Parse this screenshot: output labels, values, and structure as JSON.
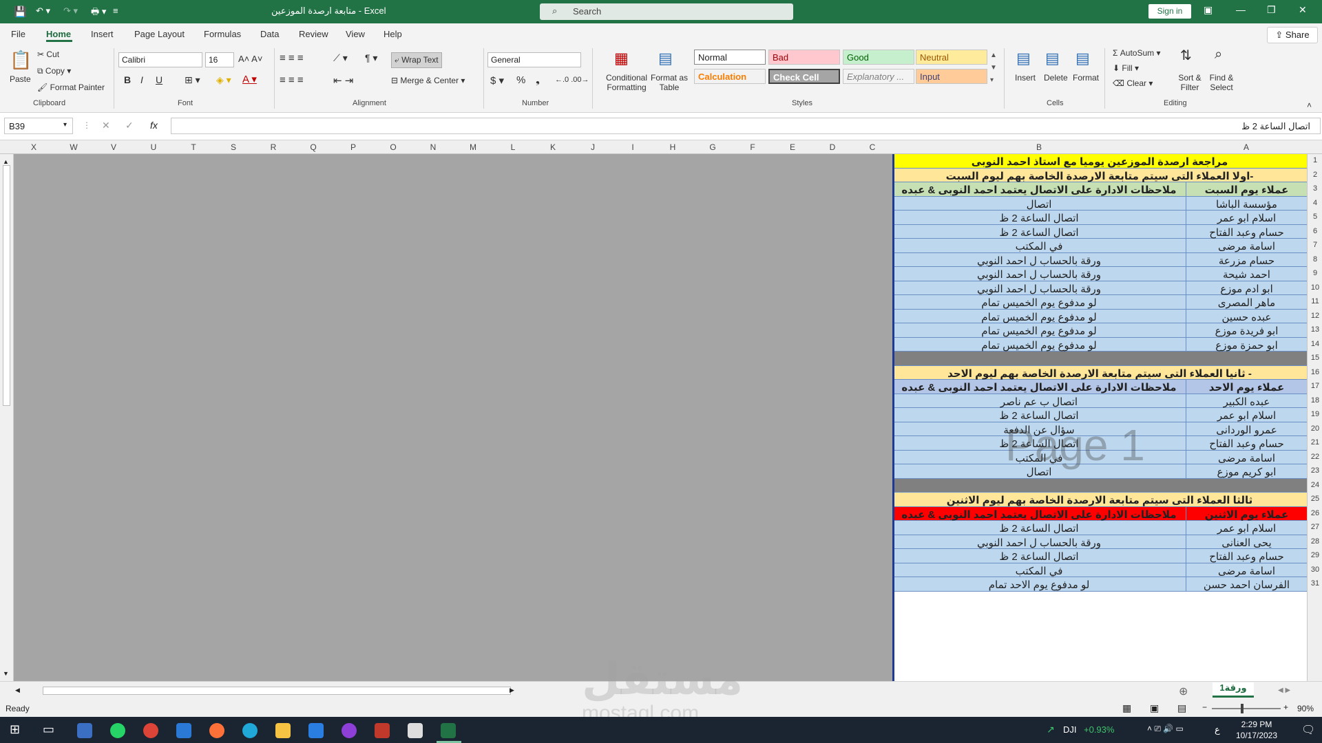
{
  "window": {
    "title": "متابعة ارصدة الموزعين  -  Excel",
    "search_placeholder": "Search",
    "sign_in": "Sign in"
  },
  "tabs": [
    "File",
    "Home",
    "Insert",
    "Page Layout",
    "Formulas",
    "Data",
    "Review",
    "View",
    "Help"
  ],
  "share_label": "Share",
  "ribbon": {
    "clipboard": {
      "paste": "Paste",
      "cut": "Cut",
      "copy": "Copy",
      "format_painter": "Format Painter",
      "label": "Clipboard"
    },
    "font": {
      "name": "Calibri",
      "size": "16",
      "label": "Font",
      "bold": "B",
      "italic": "I",
      "underline": "U"
    },
    "alignment": {
      "wrap_text": "Wrap Text",
      "merge_center": "Merge & Center",
      "label": "Alignment"
    },
    "number": {
      "format": "General",
      "label": "Number",
      "currency": "$",
      "percent": "%"
    },
    "styles": {
      "conditional": "Conditional Formatting",
      "format_table": "Format as Table",
      "normal": "Normal",
      "bad": "Bad",
      "good": "Good",
      "neutral": "Neutral",
      "calculation": "Calculation",
      "check_cell": "Check Cell",
      "explanatory": "Explanatory ...",
      "input": "Input",
      "label": "Styles"
    },
    "cells": {
      "insert": "Insert",
      "delete": "Delete",
      "format": "Format",
      "label": "Cells"
    },
    "editing": {
      "autosum": "AutoSum",
      "fill": "Fill",
      "clear": "Clear",
      "sort_filter": "Sort & Filter",
      "find_select": "Find & Select",
      "label": "Editing"
    }
  },
  "formula_bar": {
    "name_box": "B39",
    "fx": "fx",
    "content": "اتصال الساعة 2 ظ"
  },
  "column_headers": [
    "X",
    "W",
    "V",
    "U",
    "T",
    "S",
    "R",
    "Q",
    "P",
    "O",
    "N",
    "M",
    "L",
    "K",
    "J",
    "I",
    "H",
    "G",
    "F",
    "E",
    "D",
    "C",
    "B",
    "A"
  ],
  "rows": [
    {
      "n": "1",
      "type": "full",
      "text": "مراجعة ارصدة الموزعين يوميا مع استاذ احمد النوبى",
      "bg": "#ffff00"
    },
    {
      "n": "2",
      "type": "full",
      "text": "-اولا العملاء التى سيتم متابعة الارصدة الخاصة بهم ليوم السبت",
      "bg": "#ffe699"
    },
    {
      "n": "3",
      "type": "header",
      "a": "عملاء يوم السبت",
      "b": "ملاحظات الادارة على الاتصال يعتمد احمد النوبى & عبده خضر",
      "bg": "#c6e0b4"
    },
    {
      "n": "4",
      "a": "مؤسسة الباشا",
      "b": "اتصال"
    },
    {
      "n": "5",
      "a": "اسلام ابو عمر",
      "b": "اتصال الساعة 2 ظ"
    },
    {
      "n": "6",
      "a": "حسام وعبد الفتاح",
      "b": "اتصال الساعة 2 ظ"
    },
    {
      "n": "7",
      "a": "اسامة مرضى",
      "b": "في المكتب"
    },
    {
      "n": "8",
      "a": "حسام مزرعة",
      "b": "ورقة بالحساب ل احمد النوبي"
    },
    {
      "n": "9",
      "a": "احمد شيحة",
      "b": "ورقة بالحساب ل احمد النوبي"
    },
    {
      "n": "10",
      "a": "ابو ادم موزع",
      "b": "ورقة بالحساب ل احمد النوبي"
    },
    {
      "n": "11",
      "a": "ماهر المصرى",
      "b": "لو مدفوع يوم الخميس تمام"
    },
    {
      "n": "12",
      "a": "عبده حسين",
      "b": "لو مدفوع يوم الخميس تمام"
    },
    {
      "n": "13",
      "a": "ابو فريدة موزع",
      "b": "لو مدفوع يوم الخميس تمام"
    },
    {
      "n": "14",
      "a": "ابو حمزة موزع",
      "b": "لو مدفوع يوم الخميس تمام"
    },
    {
      "n": "15",
      "type": "blank",
      "bg": "#808080"
    },
    {
      "n": "16",
      "type": "full",
      "text": "- ثانيا العملاء التى سيتم متابعة الارصدة الخاصة بهم ليوم الاحد",
      "bg": "#ffe699"
    },
    {
      "n": "17",
      "type": "header",
      "a": "عملاء يوم الاحد",
      "b": "ملاحظات الادارة على الاتصال يعتمد احمد النوبى & عبده خضر",
      "bg": "#b4c6e7"
    },
    {
      "n": "18",
      "a": "عبده الكبير",
      "b": "اتصال ب عم ناصر"
    },
    {
      "n": "19",
      "a": "اسلام ابو عمر",
      "b": "اتصال الساعة 2 ظ"
    },
    {
      "n": "20",
      "a": "عمرو الوردانى",
      "b": "سؤال عن الدفعة"
    },
    {
      "n": "21",
      "a": "حسام وعبد الفتاح",
      "b": "اتصال الساعة 2 ظ"
    },
    {
      "n": "22",
      "a": "اسامة مرضى",
      "b": "في المكتب"
    },
    {
      "n": "23",
      "a": "ابو كريم موزع",
      "b": "اتصال"
    },
    {
      "n": "24",
      "type": "blank",
      "bg": "#808080"
    },
    {
      "n": "25",
      "type": "full",
      "text": "ثالثا العملاء التى سيتم متابعة الارصدة الخاصة بهم ليوم الاثنين",
      "bg": "#ffe699"
    },
    {
      "n": "26",
      "type": "header",
      "a": "عملاء يوم الاثنين",
      "b": "ملاحظات الادارة على الاتصال يعتمد احمد النوبى & عبده خضر",
      "bg": "#ff0000"
    },
    {
      "n": "27",
      "a": "اسلام ابو عمر",
      "b": "اتصال الساعة 2 ظ"
    },
    {
      "n": "28",
      "a": "يحى العنانى",
      "b": "ورقة بالحساب ل احمد النوبي"
    },
    {
      "n": "29",
      "a": "حسام وعبد الفتاح",
      "b": "اتصال الساعة 2 ظ"
    },
    {
      "n": "30",
      "a": "اسامة مرضى",
      "b": "في المكتب"
    },
    {
      "n": "31",
      "a": "الفرسان احمد حسن",
      "b": "لو مدفوع يوم الاحد تمام"
    }
  ],
  "page_watermark": "Page 1",
  "site_watermark": {
    "logo": "مستقل",
    "url": "mostaql.com"
  },
  "sheet_tab": "ورقة1",
  "status": {
    "ready": "Ready",
    "zoom": "90%"
  },
  "taskbar": {
    "ticker": "DJI",
    "change": "+0.93%",
    "time": "2:29 PM",
    "date": "10/17/2023",
    "lang": "ع"
  }
}
